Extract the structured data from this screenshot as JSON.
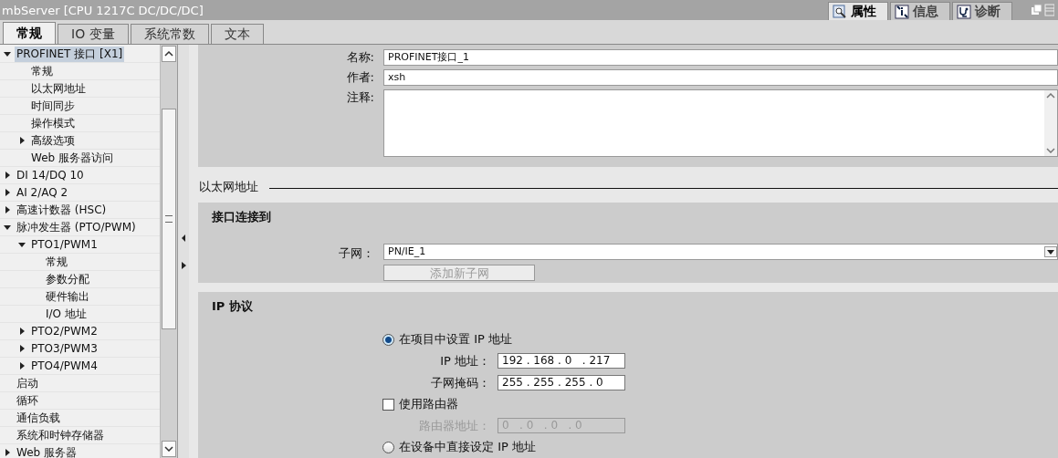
{
  "window": {
    "title": "mbServer [CPU 1217C DC/DC/DC]"
  },
  "inspector_tabs": [
    {
      "label": "属性",
      "selected": true
    },
    {
      "label": "信息",
      "selected": false
    },
    {
      "label": "诊断",
      "selected": false
    }
  ],
  "tabs": [
    {
      "label": "常规",
      "selected": true
    },
    {
      "label": "IO 变量",
      "selected": false
    },
    {
      "label": "系统常数",
      "selected": false
    },
    {
      "label": "文本",
      "selected": false
    }
  ],
  "tree": [
    {
      "label": "PROFINET 接口 [X1]",
      "selected": true,
      "expanded": true,
      "children": [
        {
          "label": "常规",
          "selected": false
        },
        {
          "label": "以太网地址",
          "selected": false
        },
        {
          "label": "时间同步",
          "selected": false
        },
        {
          "label": "操作模式",
          "selected": false
        },
        {
          "label": "高级选项",
          "selected": false,
          "expanded": false
        },
        {
          "label": "Web 服务器访问",
          "selected": false
        }
      ]
    },
    {
      "label": "DI 14/DQ 10",
      "selected": false,
      "expanded": false
    },
    {
      "label": "AI 2/AQ 2",
      "selected": false,
      "expanded": false
    },
    {
      "label": "高速计数器 (HSC)",
      "selected": false,
      "expanded": false
    },
    {
      "label": "脉冲发生器 (PTO/PWM)",
      "selected": false,
      "expanded": true,
      "children": [
        {
          "label": "PTO1/PWM1",
          "selected": false,
          "expanded": true,
          "children": [
            {
              "label": "常规",
              "selected": false
            },
            {
              "label": "参数分配",
              "selected": false
            },
            {
              "label": "硬件输出",
              "selected": false
            },
            {
              "label": "I/O 地址",
              "selected": false
            }
          ]
        },
        {
          "label": "PTO2/PWM2",
          "selected": false,
          "expanded": false
        },
        {
          "label": "PTO3/PWM3",
          "selected": false,
          "expanded": false
        },
        {
          "label": "PTO4/PWM4",
          "selected": false,
          "expanded": false
        }
      ]
    },
    {
      "label": "启动",
      "selected": false
    },
    {
      "label": "循环",
      "selected": false
    },
    {
      "label": "通信负载",
      "selected": false
    },
    {
      "label": "系统和时钟存储器",
      "selected": false
    },
    {
      "label": "Web 服务器",
      "selected": false,
      "expanded": false
    }
  ],
  "general": {
    "name_label": "名称:",
    "name_value": "PROFINET接口_1",
    "author_label": "作者:",
    "author_value": "xsh",
    "comment_label": "注释:"
  },
  "ethernet": {
    "heading": "以太网地址",
    "connect_title": "接口连接到",
    "subnet_label": "子网：",
    "subnet_value": "PN/IE_1",
    "add_subnet_button": "添加新子网",
    "add_subnet_disabled": true
  },
  "ip": {
    "title": "IP 协议",
    "options": [
      {
        "kind": "radio",
        "label": "在项目中设置 IP 地址",
        "selected": true
      },
      {
        "kind": "field",
        "label": "IP 地址：",
        "value": "192 . 168 . 0   . 217",
        "disabled": false
      },
      {
        "kind": "field",
        "label": "子网掩码：",
        "value": "255 . 255 . 255 . 0",
        "disabled": false
      },
      {
        "kind": "checkbox",
        "label": "使用路由器",
        "checked": false
      },
      {
        "kind": "field",
        "label": "路由器地址：",
        "value": "0   . 0   . 0   . 0",
        "disabled": true
      },
      {
        "kind": "radio",
        "label": "在设备中直接设定 IP 地址",
        "selected": false
      }
    ]
  }
}
